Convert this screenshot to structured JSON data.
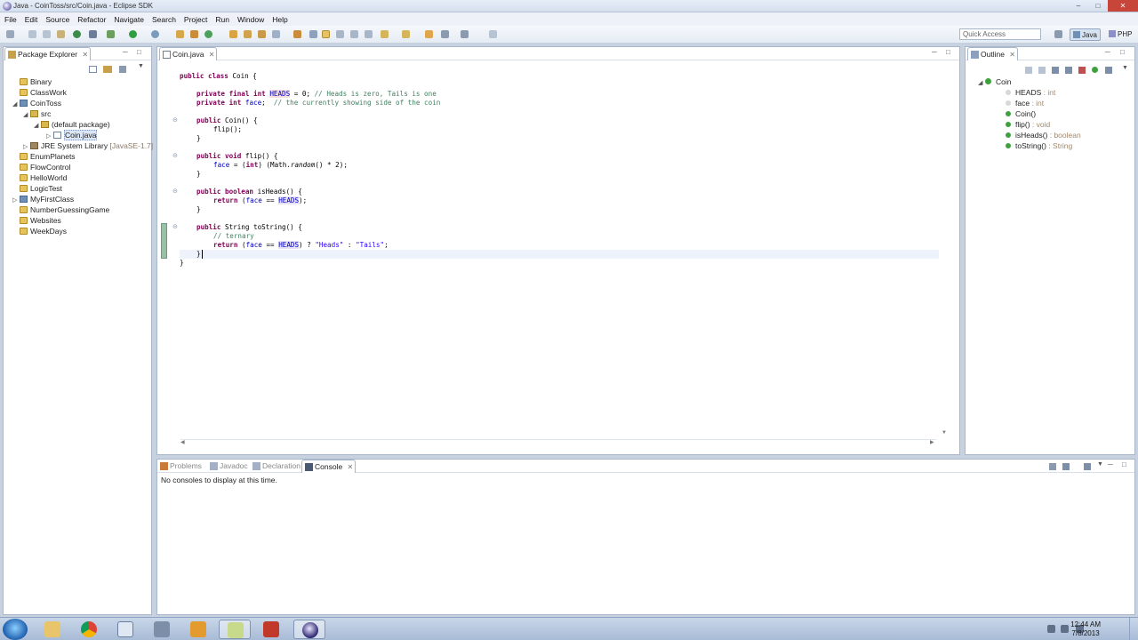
{
  "window": {
    "title": "Java - CoinToss/src/Coin.java - Eclipse SDK"
  },
  "menubar": {
    "items": [
      "File",
      "Edit",
      "Source",
      "Refactor",
      "Navigate",
      "Search",
      "Project",
      "Run",
      "Window",
      "Help"
    ]
  },
  "toolbar": {
    "quick_access_placeholder": "Quick Access",
    "perspectives": [
      "Java",
      "PHP"
    ]
  },
  "package_explorer": {
    "tab": "Package Explorer",
    "tree": [
      {
        "label": "Binary",
        "icon": "folder-icon"
      },
      {
        "label": "ClassWork",
        "icon": "folder-icon"
      },
      {
        "label": "CoinToss",
        "icon": "project-icon"
      },
      {
        "label": "src",
        "icon": "source-folder-icon"
      },
      {
        "label": "(default package)",
        "icon": "package-icon"
      },
      {
        "label": "Coin.java",
        "icon": "java-file-icon"
      },
      {
        "label": "JRE System Library",
        "suffix": "[JavaSE-1.7]",
        "icon": "library-icon"
      },
      {
        "label": "EnumPlanets",
        "icon": "folder-icon"
      },
      {
        "label": "FlowControl",
        "icon": "folder-icon"
      },
      {
        "label": "HelloWorld",
        "icon": "folder-icon"
      },
      {
        "label": "LogicTest",
        "icon": "folder-icon"
      },
      {
        "label": "MyFirstClass",
        "icon": "project-icon"
      },
      {
        "label": "NumberGuessingGame",
        "icon": "folder-icon"
      },
      {
        "label": "Websites",
        "icon": "folder-icon"
      },
      {
        "label": "WeekDays",
        "icon": "folder-icon"
      }
    ]
  },
  "editor": {
    "tab": "Coin.java",
    "code": {
      "l1a": "public class",
      "l1b": " Coin {",
      "l3a": "private final int",
      "l3b": "HEADS",
      "l3c": " = 0; ",
      "l3d": "// Heads is zero, Tails is one",
      "l4a": "private int",
      "l4b": "face",
      "l4c": ";  ",
      "l4d": "// the currently showing side of the coin",
      "l6a": "public",
      "l6b": " Coin() {",
      "l7": "flip();",
      "l8": "}",
      "l10a": "public void",
      "l10b": " flip() {",
      "l11a": "face",
      "l11b": " = (",
      "l11c": "int",
      "l11d": ") (Math.",
      "l11e": "random",
      "l11f": "() * 2);",
      "l12": "}",
      "l14a": "public boolean",
      "l14b": " isHeads() {",
      "l15a": "return",
      "l15b": " (",
      "l15c": "face",
      "l15d": " == ",
      "l15e": "HEADS",
      "l15f": ");",
      "l16": "}",
      "l18a": "public",
      "l18b": " String toString() {",
      "l19": "// ternary",
      "l20a": "return",
      "l20b": " (",
      "l20c": "face",
      "l20d": " == ",
      "l20e": "HEADS",
      "l20f": ") ? ",
      "l20g": "\"Heads\"",
      "l20h": " : ",
      "l20i": "\"Tails\"",
      "l20j": ";",
      "l21": "}",
      "l22": "}"
    }
  },
  "outline": {
    "tab": "Outline",
    "root": "Coin",
    "items": [
      {
        "name": "HEADS",
        "type": " : int"
      },
      {
        "name": "face",
        "type": " : int"
      },
      {
        "name": "Coin()",
        "type": ""
      },
      {
        "name": "flip()",
        "type": " : void"
      },
      {
        "name": "isHeads()",
        "type": " : boolean"
      },
      {
        "name": "toString()",
        "type": " : String"
      }
    ]
  },
  "bottom_panel": {
    "tabs": [
      "Problems",
      "Javadoc",
      "Declaration",
      "Console"
    ],
    "message": "No consoles to display at this time."
  },
  "taskbar": {
    "time": "12:44 AM",
    "date": "7/8/2013"
  }
}
